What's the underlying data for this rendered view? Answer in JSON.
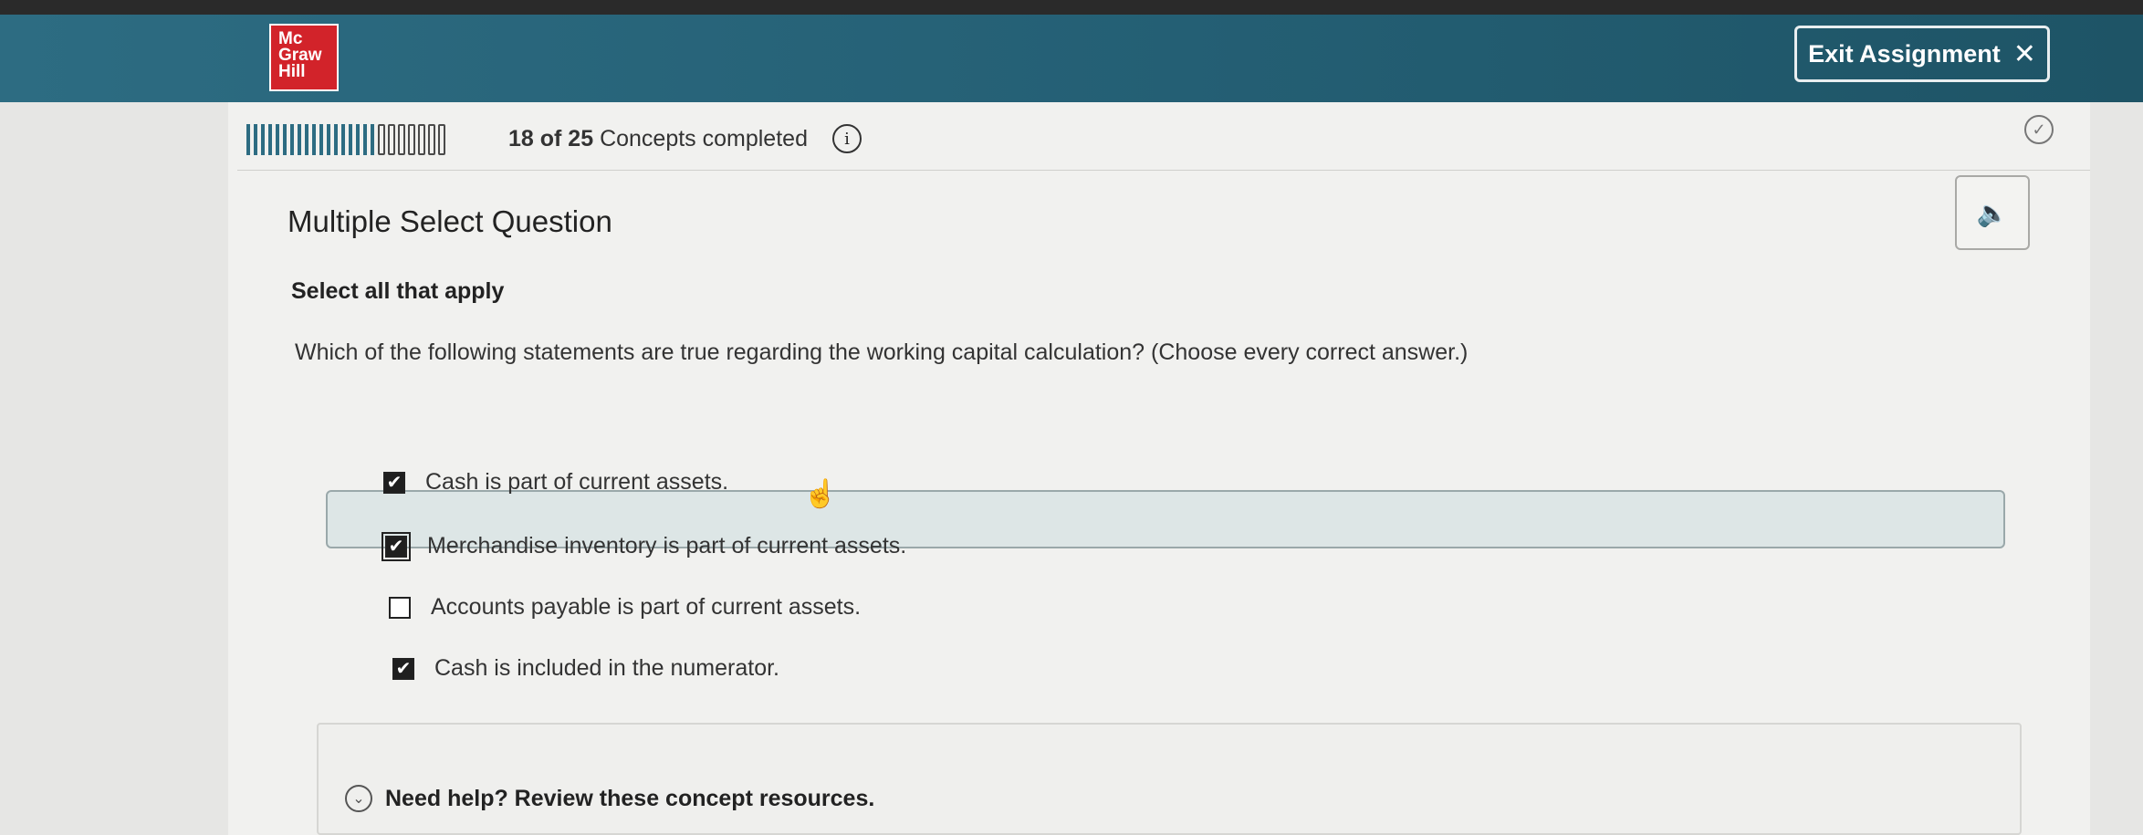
{
  "logo": {
    "lines": [
      "Mc",
      "Graw",
      "Hill"
    ]
  },
  "header": {
    "exit_label": "Exit Assignment",
    "exit_icon": "✕"
  },
  "progress": {
    "completed": 18,
    "total": 25,
    "count_text": "18 of 25",
    "label": "Concepts completed",
    "info_glyph": "i"
  },
  "question": {
    "title": "Multiple Select Question",
    "instruction": "Select all that apply",
    "prompt": "Which of the following statements are true regarding the working capital calculation? (Choose every correct answer.)"
  },
  "options": [
    {
      "label": "Cash is part of current assets.",
      "checked": true
    },
    {
      "label": "Merchandise inventory is part of current assets.",
      "checked": true,
      "focused": true
    },
    {
      "label": "Accounts payable is part of current assets.",
      "checked": false
    },
    {
      "label": "Cash is included in the numerator.",
      "checked": true
    }
  ],
  "help": {
    "label": "Need help? Review these concept resources."
  },
  "icons": {
    "audio": "speaker-icon",
    "status": "check-circle-icon",
    "expand": "chevron-down-icon",
    "cursor": "hand-pointer-icon"
  },
  "colors": {
    "header": "#2d6c82",
    "brand_red": "#d2232a",
    "highlight": "#dde6e6"
  }
}
